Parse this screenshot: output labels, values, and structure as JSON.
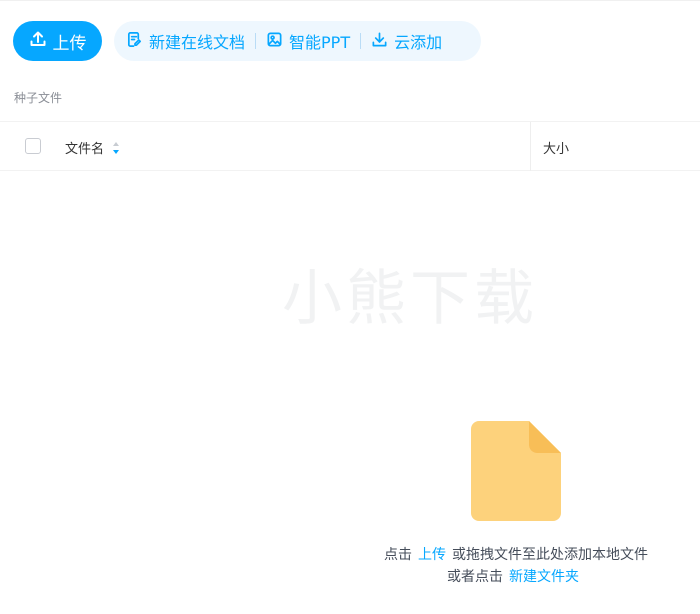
{
  "toolbar": {
    "upload_label": "上传",
    "new_doc_label": "新建在线文档",
    "smart_ppt_label": "智能PPT",
    "cloud_add_label": "云添加"
  },
  "breadcrumb": {
    "current": "种子文件"
  },
  "table": {
    "columns": {
      "name": "文件名",
      "size": "大小"
    }
  },
  "watermark": "小熊下载",
  "empty_state": {
    "prefix": "点击",
    "upload_link": "上传",
    "middle": "或拖拽文件至此处添加本地文件",
    "line2_prefix": "或者点击",
    "new_folder_link": "新建文件夹"
  },
  "colors": {
    "accent": "#06a7ff",
    "toolbar_bg": "#eef7fe",
    "file_icon_main": "#fdd27c",
    "file_icon_corner": "#f7b94c"
  },
  "icons": {
    "upload": "upload-icon",
    "new_doc": "edit-doc-icon",
    "smart_ppt": "ppt-image-icon",
    "cloud_add": "download-icon",
    "sort": "sort-icon",
    "empty": "empty-file-icon"
  }
}
